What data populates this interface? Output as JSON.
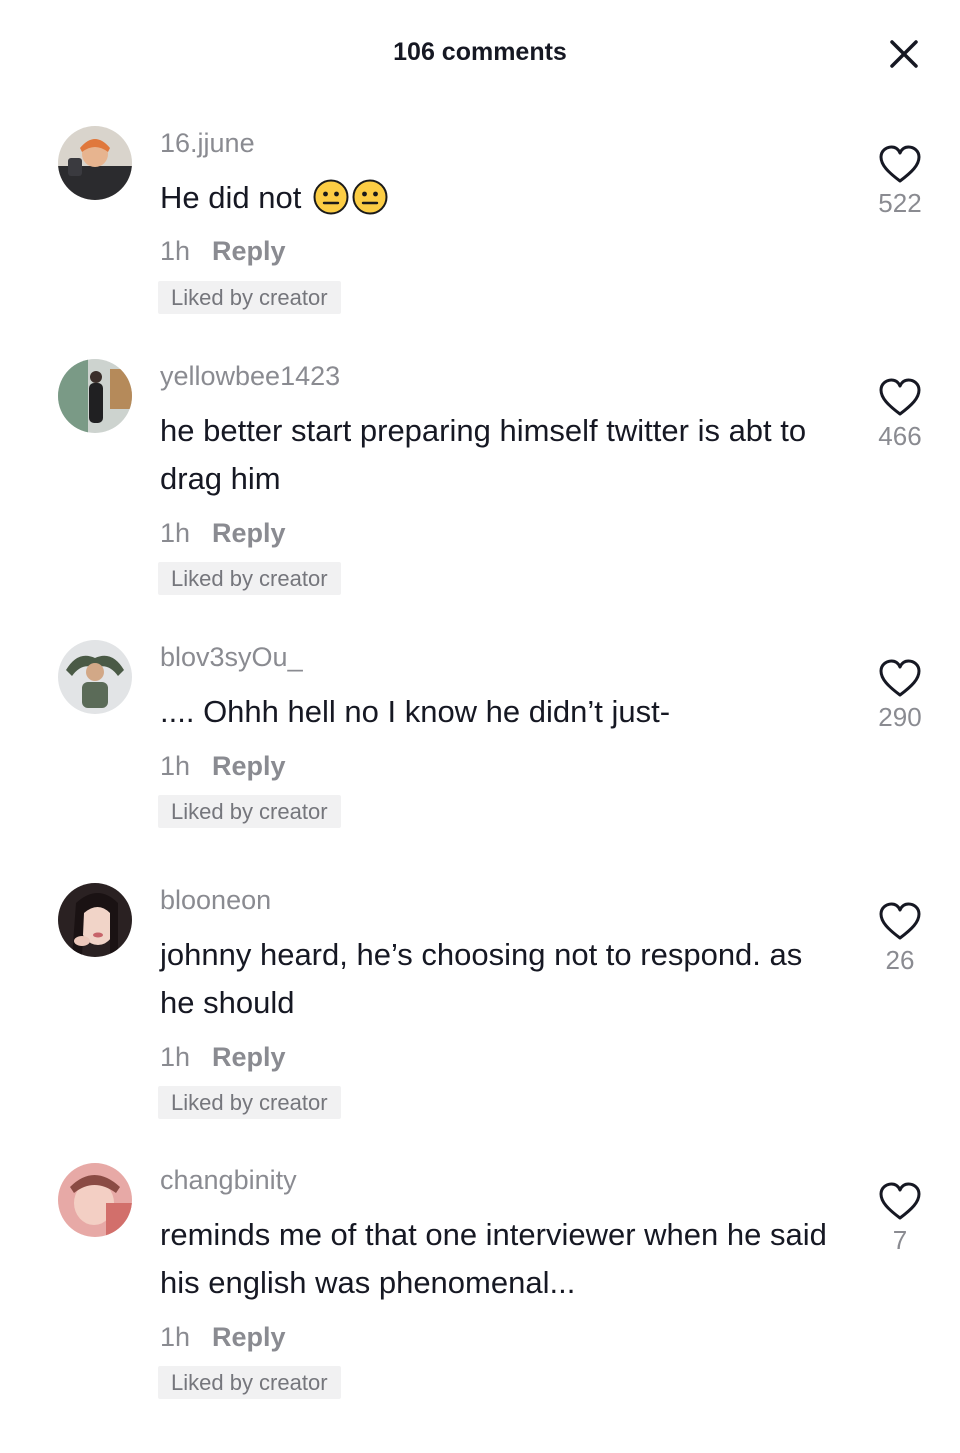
{
  "header": {
    "title": "106 comments",
    "close_icon": "close-icon"
  },
  "comments": [
    {
      "username": "16.jjune",
      "text": "He did not",
      "emojis": [
        "neutral-face-emoji",
        "neutral-face-emoji"
      ],
      "time": "1h",
      "reply_label": "Reply",
      "badge": "Liked by creator",
      "likes": "522"
    },
    {
      "username": "yellowbee1423",
      "text": "he better start preparing himself twitter is abt to drag him",
      "time": "1h",
      "reply_label": "Reply",
      "badge": "Liked by creator",
      "likes": "466"
    },
    {
      "username": "blov3syOu_",
      "text": ".... Ohhh hell no I know he didn’t just-",
      "time": "1h",
      "reply_label": "Reply",
      "badge": "Liked by creator",
      "likes": "290"
    },
    {
      "username": "blooneon",
      "text": "johnny heard, he’s choosing not to respond. as he should",
      "time": "1h",
      "reply_label": "Reply",
      "badge": "Liked by creator",
      "likes": "26"
    },
    {
      "username": "changbinity",
      "text": "reminds me of that one interviewer when he said his english was phenomenal...",
      "time": "1h",
      "reply_label": "Reply",
      "badge": "Liked by creator",
      "likes": "7"
    }
  ],
  "colors": {
    "text_primary": "#161823",
    "text_secondary": "#8a8b91",
    "badge_bg": "#f1f1f2",
    "emoji_yellow": "#fccd44"
  }
}
